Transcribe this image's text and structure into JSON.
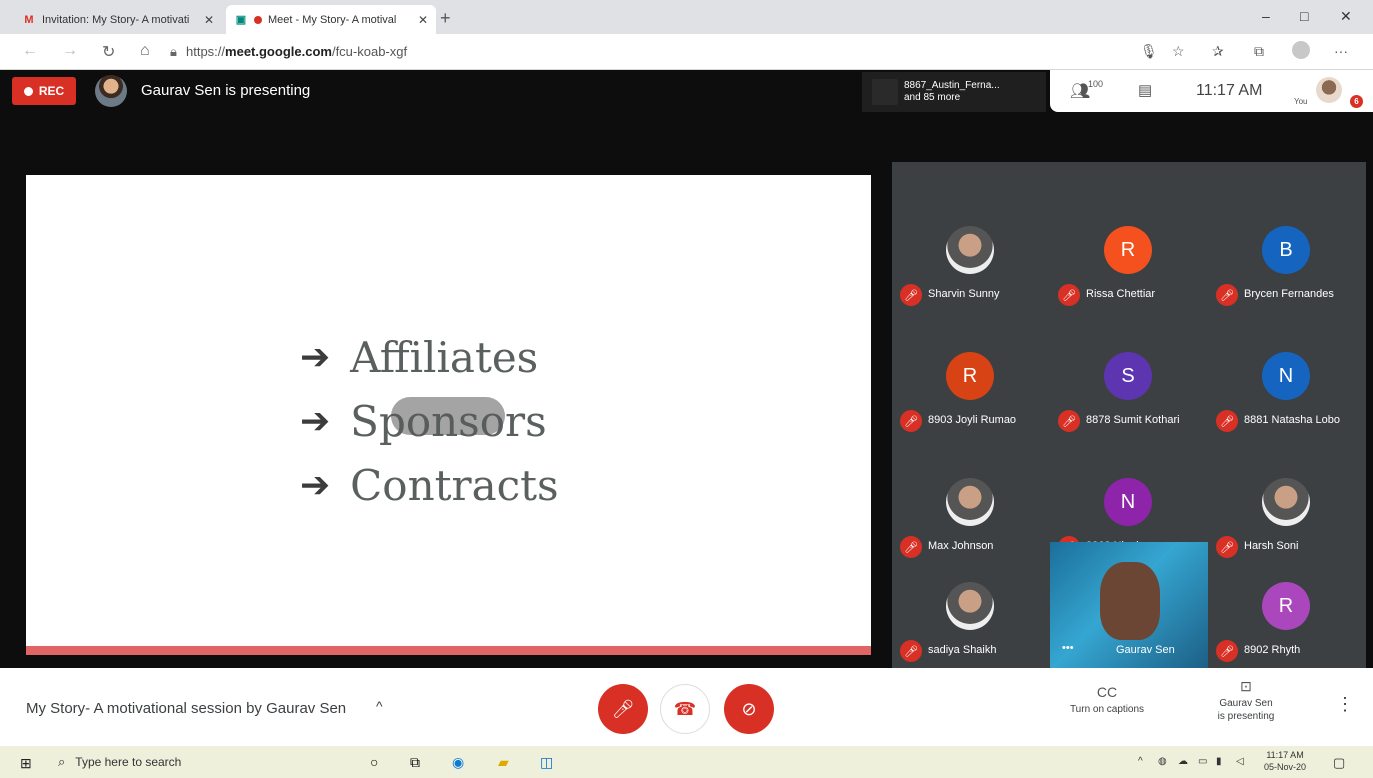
{
  "browser": {
    "tabs": [
      {
        "title": "Invitation: My Story- A motivati",
        "favicon": "gmail-icon"
      },
      {
        "title": "Meet - My Story- A motival",
        "favicon": "meet-icon",
        "recording": true
      }
    ],
    "new_tab": "+",
    "url_prefix": "https://",
    "url_domain": "meet.google.com",
    "url_path": "/fcu-koab-xgf",
    "window": {
      "minimize": "–",
      "restore": "□",
      "close": "✕"
    }
  },
  "meet": {
    "rec_label": "REC",
    "presenting_text": "Gaurav Sen is presenting",
    "others_chip": {
      "line1": "8867_Austin_Ferna...",
      "line2": "and 85 more"
    },
    "people_count": "100",
    "time": "11:17 AM",
    "you_label": "You",
    "me_badge": "6",
    "slide": {
      "bullets": [
        "Affiliates",
        "Sponsors",
        "Contracts"
      ],
      "arrow": "➔"
    },
    "participants": [
      {
        "name": "Sharvin Sunny",
        "initial": "",
        "color": "#555555",
        "photo": true
      },
      {
        "name": "Rissa Chettiar",
        "initial": "R",
        "color": "#f4511e"
      },
      {
        "name": "Brycen Fernandes",
        "initial": "B",
        "color": "#1565c0"
      },
      {
        "name": "8903 Joyli Rumao",
        "initial": "R",
        "color": "#d84315"
      },
      {
        "name": "8878 Sumit Kothari",
        "initial": "S",
        "color": "#5e35b1"
      },
      {
        "name": "8881 Natasha Lobo",
        "initial": "N",
        "color": "#1565c0"
      },
      {
        "name": "Max Johnson",
        "initial": "",
        "color": "#555555",
        "photo": true
      },
      {
        "name": "8868 Nigel",
        "initial": "N",
        "color": "#8e24aa"
      },
      {
        "name": "Harsh Soni",
        "initial": "",
        "color": "#555555",
        "photo": true
      },
      {
        "name": "sadiya Shaikh",
        "initial": "",
        "color": "#555555",
        "photo": true
      },
      {
        "name": "Gaurav Sen",
        "initial": "",
        "color": "#1b6f9a",
        "video": true
      },
      {
        "name": "8902 Rhyth",
        "initial": "R",
        "color": "#ab47bc"
      }
    ],
    "bottom": {
      "meeting_title": "My Story- A motivational session by Gaurav Sen",
      "caret": "^",
      "captions_label": "Turn on captions",
      "captions_icon": "CC",
      "presenting_line1": "Gaurav Sen",
      "presenting_line2": "is presenting",
      "more": "⋮"
    }
  },
  "taskbar": {
    "search_placeholder": "Type here to search",
    "time": "11:17 AM",
    "date": "05-Nov-20"
  }
}
